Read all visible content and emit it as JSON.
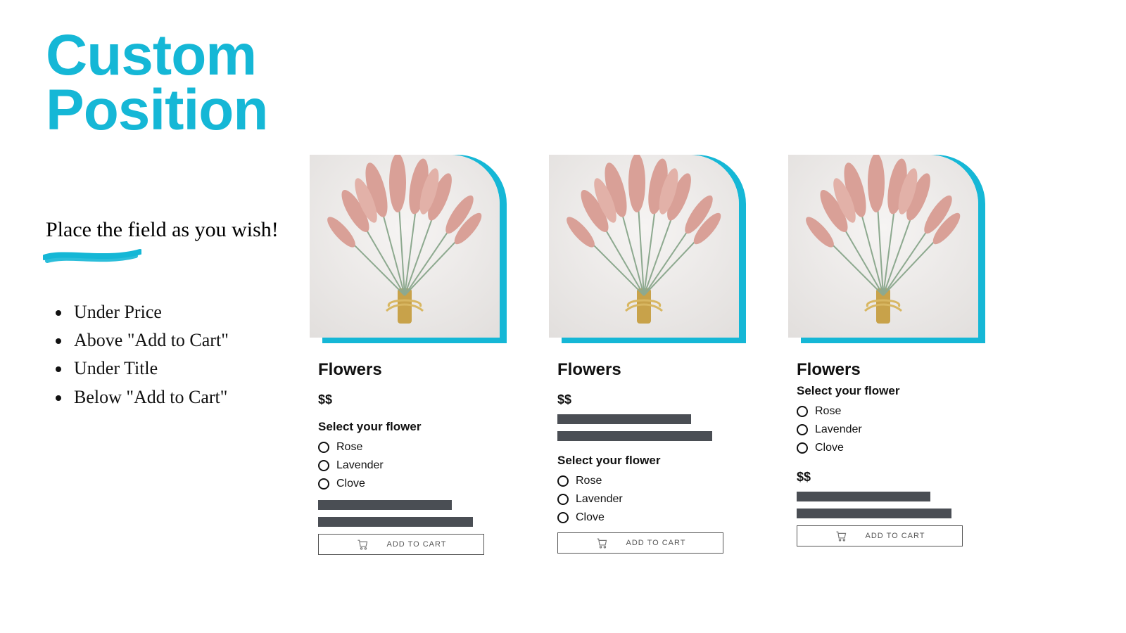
{
  "colors": {
    "accent": "#15b7d6",
    "dark_bar": "#4a4e54"
  },
  "headline_line1": "Custom",
  "headline_line2": "Position",
  "tagline": "Place the field as you wish!",
  "bullets": [
    "Under Price",
    "Above \"Add to Cart\"",
    "Under Title",
    "Below \"Add to Cart\""
  ],
  "shared": {
    "product_title": "Flowers",
    "price": "$$",
    "select_label": "Select your flower",
    "options": [
      "Rose",
      "Lavender",
      "Clove"
    ],
    "add_to_cart": "ADD TO CART"
  },
  "cards": [
    {
      "layout": "under_price",
      "sequence": [
        "title",
        "price",
        "select",
        "bars",
        "cart"
      ]
    },
    {
      "layout": "above_add_cart",
      "sequence": [
        "title",
        "price",
        "bars",
        "select",
        "cart"
      ]
    },
    {
      "layout": "under_title",
      "sequence": [
        "title",
        "select",
        "price",
        "bars",
        "cart"
      ]
    }
  ]
}
